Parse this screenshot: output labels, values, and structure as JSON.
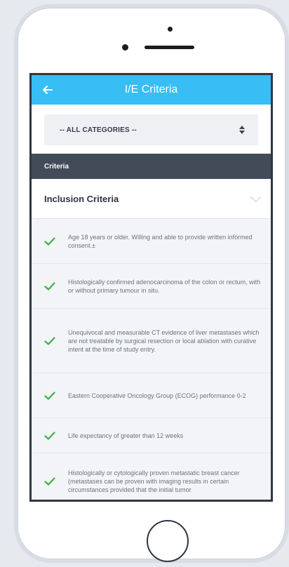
{
  "header": {
    "title": "I/E Criteria"
  },
  "filter": {
    "selected": "-- ALL CATEGORIES --"
  },
  "section": {
    "label": "Criteria"
  },
  "group": {
    "title": "Inclusion Criteria"
  },
  "colors": {
    "accent": "#38bdf4",
    "check": "#3cb043",
    "section_bg": "#434b58"
  },
  "criteria": [
    "Age 18 years or older. Willing and able to provide written informed consent.±",
    "Histologically confirmed adenocarcinoma of the colon or rectum, with or without primary tumour in situ.",
    "Unequivocal and measurable CT evidence of liver metastases which are not treatable by surgical resection or local ablation with curative intent at the time of study entry.",
    "Eastern Cooperative Oncology Group (ECOG) performance 0-2",
    "Life expectancy of greater than 12 weeks",
    "Histologically or cytologically proven metastatic breast cancer (metastases can be proven with imaging results in certain circumstances provided that the initial tumor"
  ]
}
